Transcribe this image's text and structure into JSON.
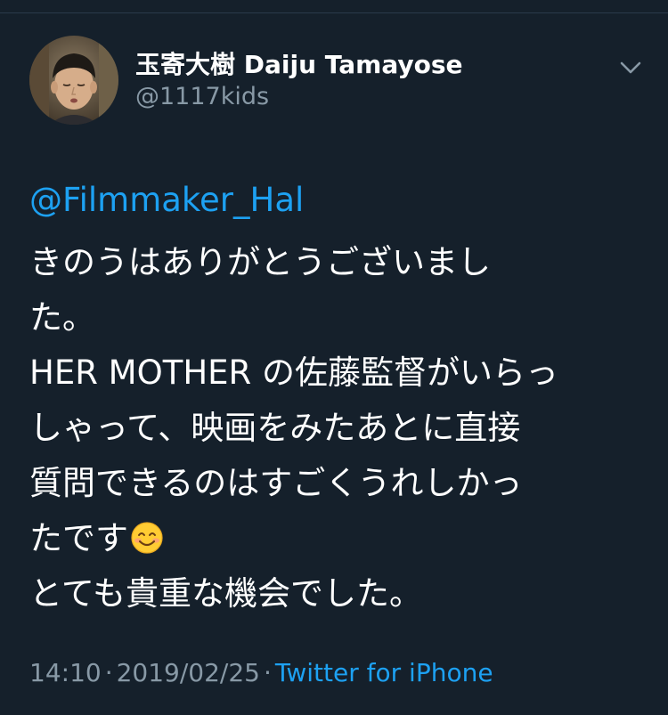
{
  "author": {
    "display_name": "玉寄大樹 Daiju Tamayose",
    "handle": "@1117kids"
  },
  "icons": {
    "menu": "chevron-down-icon",
    "emoji": "smiling-face-with-smiling-eyes"
  },
  "tweet": {
    "mention": "@Filmmaker_Hal",
    "lines": [
      "きのうはありがとうございまし",
      "た。",
      "HER MOTHER の佐藤監督がいらっ",
      "しゃって、映画をみたあとに直接",
      "質問できるのはすごくうれしかっ",
      "たです",
      "とても貴重な機会でした。"
    ]
  },
  "meta": {
    "time": "14:10",
    "separator": "·",
    "date": "2019/02/25",
    "source": "Twitter for iPhone"
  },
  "colors": {
    "background": "#15202b",
    "link": "#1da1f2",
    "secondary_text": "#8899a6",
    "primary_text": "#ffffff"
  }
}
